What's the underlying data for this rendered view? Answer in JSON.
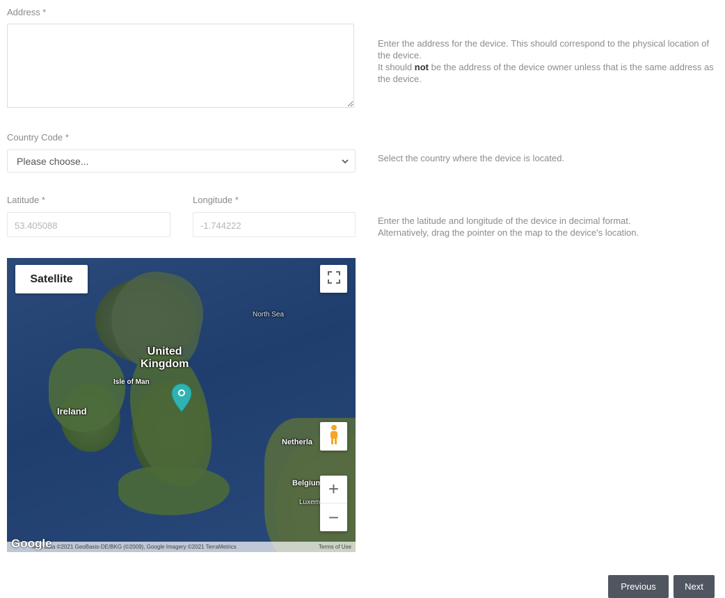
{
  "address": {
    "label": "Address *",
    "value": "",
    "help_line1": "Enter the address for the device. This should correspond to the physical location of the device.",
    "help_line2_pre": "It should ",
    "help_line2_bold": "not",
    "help_line2_post": " be the address of the device owner unless that is the same address as the device."
  },
  "country": {
    "label": "Country Code *",
    "selected": "Please choose...",
    "help": "Select the country where the device is located."
  },
  "coordinates": {
    "latitude_label": "Latitude *",
    "latitude_value": "53.405088",
    "longitude_label": "Longitude *",
    "longitude_value": "-1.744222",
    "help_line1": "Enter the latitude and longitude of the device in decimal format.",
    "help_line2": "Alternatively, drag the pointer on the map to the device's location."
  },
  "map": {
    "map_type_button": "Satellite",
    "labels": {
      "north_sea": "North Sea",
      "uk_line1": "United",
      "uk_line2": "Kingdom",
      "isle_of_man": "Isle of Man",
      "ireland": "Ireland",
      "netherlands": "Netherla",
      "belgium": "Belgium",
      "luxembourg": "Luxemb"
    },
    "logo": "Google",
    "attribution": "Map data ©2021 GeoBasis-DE/BKG (©2009), Google Imagery ©2021 TerraMetrics",
    "terms": "Terms of Use",
    "zoom_in": "+",
    "zoom_out": "−",
    "pin_color": "#2fb3b0"
  },
  "nav": {
    "previous": "Previous",
    "next": "Next"
  },
  "colors": {
    "button_bg": "#4f5660",
    "help_text": "#8c8c8c"
  }
}
